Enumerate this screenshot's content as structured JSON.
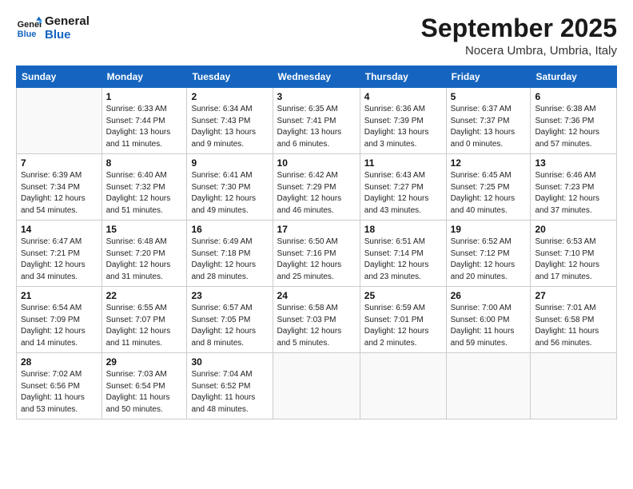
{
  "logo": {
    "line1": "General",
    "line2": "Blue"
  },
  "title": "September 2025",
  "subtitle": "Nocera Umbra, Umbria, Italy",
  "headers": [
    "Sunday",
    "Monday",
    "Tuesday",
    "Wednesday",
    "Thursday",
    "Friday",
    "Saturday"
  ],
  "weeks": [
    [
      {
        "day": "",
        "info": ""
      },
      {
        "day": "1",
        "info": "Sunrise: 6:33 AM\nSunset: 7:44 PM\nDaylight: 13 hours\nand 11 minutes."
      },
      {
        "day": "2",
        "info": "Sunrise: 6:34 AM\nSunset: 7:43 PM\nDaylight: 13 hours\nand 9 minutes."
      },
      {
        "day": "3",
        "info": "Sunrise: 6:35 AM\nSunset: 7:41 PM\nDaylight: 13 hours\nand 6 minutes."
      },
      {
        "day": "4",
        "info": "Sunrise: 6:36 AM\nSunset: 7:39 PM\nDaylight: 13 hours\nand 3 minutes."
      },
      {
        "day": "5",
        "info": "Sunrise: 6:37 AM\nSunset: 7:37 PM\nDaylight: 13 hours\nand 0 minutes."
      },
      {
        "day": "6",
        "info": "Sunrise: 6:38 AM\nSunset: 7:36 PM\nDaylight: 12 hours\nand 57 minutes."
      }
    ],
    [
      {
        "day": "7",
        "info": "Sunrise: 6:39 AM\nSunset: 7:34 PM\nDaylight: 12 hours\nand 54 minutes."
      },
      {
        "day": "8",
        "info": "Sunrise: 6:40 AM\nSunset: 7:32 PM\nDaylight: 12 hours\nand 51 minutes."
      },
      {
        "day": "9",
        "info": "Sunrise: 6:41 AM\nSunset: 7:30 PM\nDaylight: 12 hours\nand 49 minutes."
      },
      {
        "day": "10",
        "info": "Sunrise: 6:42 AM\nSunset: 7:29 PM\nDaylight: 12 hours\nand 46 minutes."
      },
      {
        "day": "11",
        "info": "Sunrise: 6:43 AM\nSunset: 7:27 PM\nDaylight: 12 hours\nand 43 minutes."
      },
      {
        "day": "12",
        "info": "Sunrise: 6:45 AM\nSunset: 7:25 PM\nDaylight: 12 hours\nand 40 minutes."
      },
      {
        "day": "13",
        "info": "Sunrise: 6:46 AM\nSunset: 7:23 PM\nDaylight: 12 hours\nand 37 minutes."
      }
    ],
    [
      {
        "day": "14",
        "info": "Sunrise: 6:47 AM\nSunset: 7:21 PM\nDaylight: 12 hours\nand 34 minutes."
      },
      {
        "day": "15",
        "info": "Sunrise: 6:48 AM\nSunset: 7:20 PM\nDaylight: 12 hours\nand 31 minutes."
      },
      {
        "day": "16",
        "info": "Sunrise: 6:49 AM\nSunset: 7:18 PM\nDaylight: 12 hours\nand 28 minutes."
      },
      {
        "day": "17",
        "info": "Sunrise: 6:50 AM\nSunset: 7:16 PM\nDaylight: 12 hours\nand 25 minutes."
      },
      {
        "day": "18",
        "info": "Sunrise: 6:51 AM\nSunset: 7:14 PM\nDaylight: 12 hours\nand 23 minutes."
      },
      {
        "day": "19",
        "info": "Sunrise: 6:52 AM\nSunset: 7:12 PM\nDaylight: 12 hours\nand 20 minutes."
      },
      {
        "day": "20",
        "info": "Sunrise: 6:53 AM\nSunset: 7:10 PM\nDaylight: 12 hours\nand 17 minutes."
      }
    ],
    [
      {
        "day": "21",
        "info": "Sunrise: 6:54 AM\nSunset: 7:09 PM\nDaylight: 12 hours\nand 14 minutes."
      },
      {
        "day": "22",
        "info": "Sunrise: 6:55 AM\nSunset: 7:07 PM\nDaylight: 12 hours\nand 11 minutes."
      },
      {
        "day": "23",
        "info": "Sunrise: 6:57 AM\nSunset: 7:05 PM\nDaylight: 12 hours\nand 8 minutes."
      },
      {
        "day": "24",
        "info": "Sunrise: 6:58 AM\nSunset: 7:03 PM\nDaylight: 12 hours\nand 5 minutes."
      },
      {
        "day": "25",
        "info": "Sunrise: 6:59 AM\nSunset: 7:01 PM\nDaylight: 12 hours\nand 2 minutes."
      },
      {
        "day": "26",
        "info": "Sunrise: 7:00 AM\nSunset: 6:00 PM\nDaylight: 11 hours\nand 59 minutes."
      },
      {
        "day": "27",
        "info": "Sunrise: 7:01 AM\nSunset: 6:58 PM\nDaylight: 11 hours\nand 56 minutes."
      }
    ],
    [
      {
        "day": "28",
        "info": "Sunrise: 7:02 AM\nSunset: 6:56 PM\nDaylight: 11 hours\nand 53 minutes."
      },
      {
        "day": "29",
        "info": "Sunrise: 7:03 AM\nSunset: 6:54 PM\nDaylight: 11 hours\nand 50 minutes."
      },
      {
        "day": "30",
        "info": "Sunrise: 7:04 AM\nSunset: 6:52 PM\nDaylight: 11 hours\nand 48 minutes."
      },
      {
        "day": "",
        "info": ""
      },
      {
        "day": "",
        "info": ""
      },
      {
        "day": "",
        "info": ""
      },
      {
        "day": "",
        "info": ""
      }
    ]
  ]
}
